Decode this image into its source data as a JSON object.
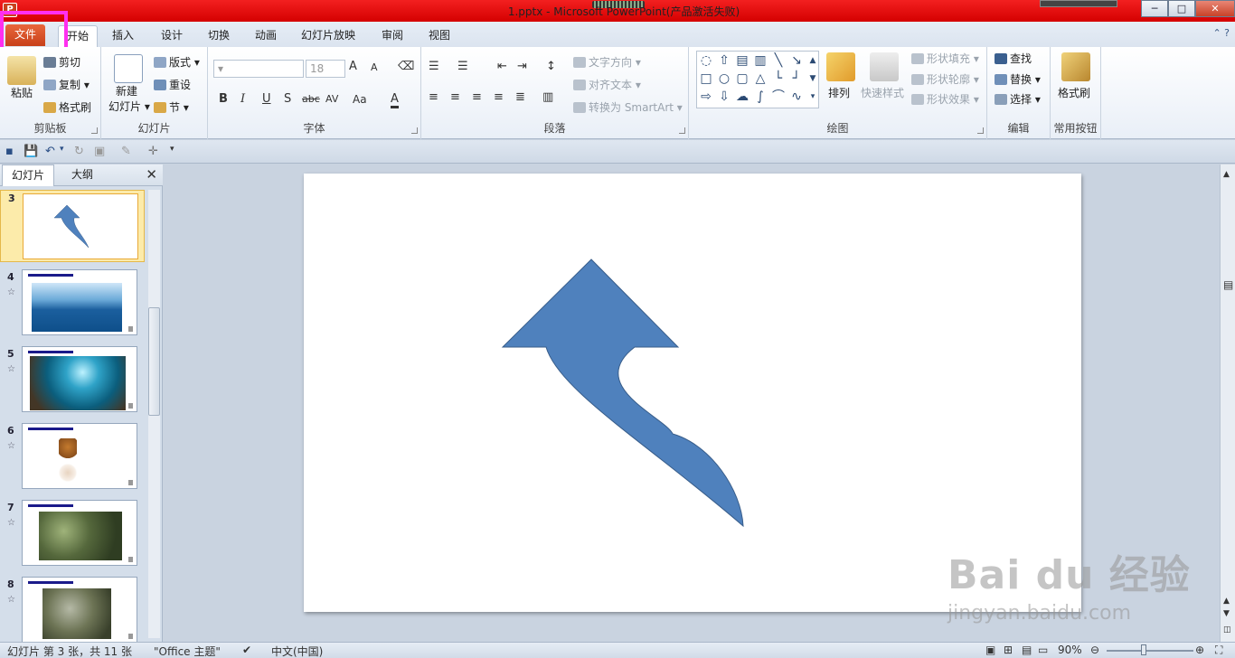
{
  "window": {
    "title": "1.pptx - Microsoft PowerPoint(产品激活失败)",
    "controls": {
      "minimize": "─",
      "maximize": "□",
      "close": "✕"
    }
  },
  "tabs": [
    {
      "id": "file",
      "label": "文件"
    },
    {
      "id": "home",
      "label": "开始"
    },
    {
      "id": "insert",
      "label": "插入"
    },
    {
      "id": "design",
      "label": "设计"
    },
    {
      "id": "transitions",
      "label": "切换"
    },
    {
      "id": "animations",
      "label": "动画"
    },
    {
      "id": "slideshow",
      "label": "幻灯片放映"
    },
    {
      "id": "review",
      "label": "审阅"
    },
    {
      "id": "view",
      "label": "视图"
    }
  ],
  "ribbon": {
    "clipboard": {
      "label": "剪贴板",
      "paste": "粘贴",
      "cut": "剪切",
      "copy": "复制",
      "format_painter": "格式刷"
    },
    "slides": {
      "label": "幻灯片",
      "new_slide_top": "新建",
      "new_slide_bottom": "幻灯片",
      "layout": "版式",
      "reset": "重设",
      "section": "节"
    },
    "font": {
      "label": "字体",
      "font_size": "18",
      "bold": "B",
      "italic": "I",
      "underline": "U",
      "shadow": "S",
      "strike": "abc",
      "spacing": "AV",
      "case": "Aa",
      "color": "A",
      "grow": "A",
      "shrink": "A"
    },
    "paragraph": {
      "label": "段落",
      "text_direction": "文字方向",
      "align_text": "对齐文本",
      "convert_smartart": "转换为 SmartArt"
    },
    "drawing": {
      "label": "绘图",
      "arrange": "排列",
      "quick_styles": "快速样式",
      "shape_fill": "形状填充",
      "shape_outline": "形状轮廓",
      "shape_effects": "形状效果"
    },
    "editing": {
      "label": "编辑",
      "find": "查找",
      "replace": "替换",
      "select": "选择"
    },
    "common": {
      "label": "常用按钮",
      "format_painter": "格式刷"
    }
  },
  "left_pane": {
    "tabs": {
      "slides": "幻灯片",
      "outline": "大纲"
    },
    "close": "✕",
    "thumbnails": [
      {
        "number": "3",
        "selected": true,
        "kind": "arrow"
      },
      {
        "number": "4",
        "selected": false,
        "kind": "sea"
      },
      {
        "number": "5",
        "selected": false,
        "kind": "underwater"
      },
      {
        "number": "6",
        "selected": false,
        "kind": "squirrel"
      },
      {
        "number": "7",
        "selected": false,
        "kind": "trees"
      },
      {
        "number": "8",
        "selected": false,
        "kind": "plants"
      }
    ]
  },
  "status_bar": {
    "slide_info": "幻灯片 第 3 张，共 11 张",
    "theme": "\"Office 主题\"",
    "language": "中文(中国)",
    "zoom": "90%"
  },
  "watermark": {
    "brand": "Bai du 经验",
    "url": "jingyan.baidu.com"
  },
  "colors": {
    "file_tab": "#d8532a",
    "highlight": "#ff2ff0",
    "arrow_fill": "#4f81bd",
    "arrow_stroke": "#385d8a",
    "title_bar": "#e60f0f"
  }
}
